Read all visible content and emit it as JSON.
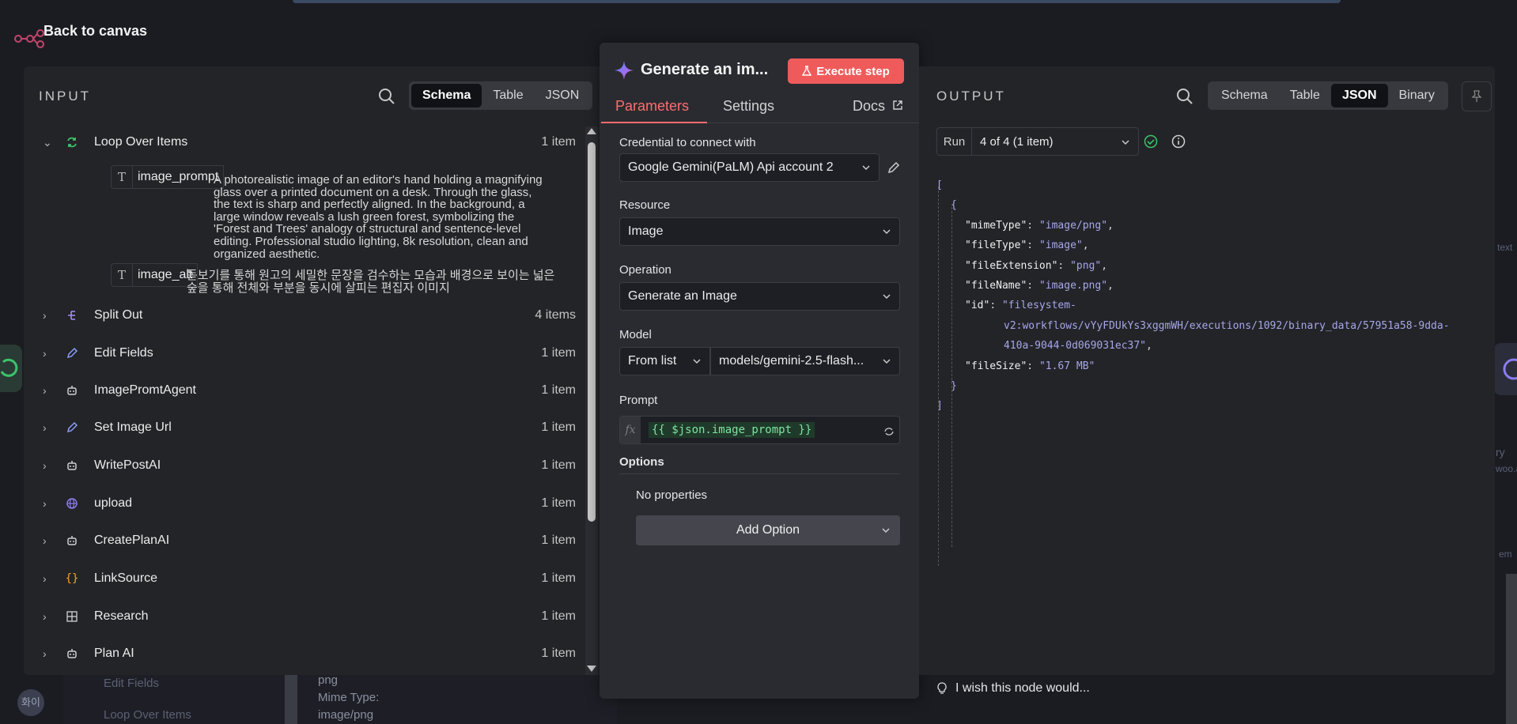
{
  "header": {
    "back_label": "Back to canvas"
  },
  "input": {
    "title": "INPUT",
    "view_tabs": [
      "Schema",
      "Table",
      "JSON"
    ],
    "active_tab": "Schema",
    "nodes": [
      {
        "label": "Loop Over Items",
        "count": "1 item",
        "icon": "loop-icon",
        "expanded": true
      },
      {
        "label": "Split Out",
        "count": "4 items",
        "icon": "split-out-icon"
      },
      {
        "label": "Edit Fields",
        "count": "1 item",
        "icon": "pencil-icon"
      },
      {
        "label": "ImagePromtAgent",
        "count": "1 item",
        "icon": "robot-icon"
      },
      {
        "label": "Set Image Url",
        "count": "1 item",
        "icon": "pencil-icon"
      },
      {
        "label": "WritePostAI",
        "count": "1 item",
        "icon": "robot-icon"
      },
      {
        "label": "upload",
        "count": "1 item",
        "icon": "globe-icon"
      },
      {
        "label": "CreatePlanAI",
        "count": "1 item",
        "icon": "robot-icon"
      },
      {
        "label": "LinkSource",
        "count": "1 item",
        "icon": "braces-icon"
      },
      {
        "label": "Research",
        "count": "1 item",
        "icon": "perplexity-icon"
      },
      {
        "label": "Plan AI",
        "count": "1 item",
        "icon": "robot-icon"
      }
    ],
    "fields": [
      {
        "name": "image_prompt",
        "type_glyph": "T",
        "value_lines": [
          "A photorealistic image of an editor's hand holding a magnifying",
          "glass over a printed document on a desk. Through the glass,",
          "the text is sharp and perfectly aligned. In the background, a",
          "large window reveals a lush green forest, symbolizing the",
          "'Forest and Trees' analogy of structural and sentence-level",
          "editing. Professional studio lighting, 8k resolution, clean and",
          "organized aesthetic."
        ]
      },
      {
        "name": "image_alt",
        "type_glyph": "T",
        "value_lines": [
          "돋보기를 통해 원고의 세밀한 문장을 검수하는 모습과 배경으로 보이는 넓은",
          "숲을 통해 전체와 부분을 동시에 살피는 편집자 이미지"
        ]
      }
    ]
  },
  "node": {
    "title": "Generate an im...",
    "execute_label": "Execute step",
    "tabs": {
      "parameters": "Parameters",
      "settings": "Settings",
      "docs": "Docs"
    },
    "credential_label": "Credential to connect with",
    "credential_value": "Google Gemini(PaLM) Api account 2",
    "resource_label": "Resource",
    "resource_value": "Image",
    "operation_label": "Operation",
    "operation_value": "Generate an Image",
    "model_label": "Model",
    "model_mode": "From list",
    "model_value": "models/gemini-2.5-flash...",
    "prompt_label": "Prompt",
    "prompt_fx": "fx",
    "prompt_value": "{{ $json.image_prompt }}",
    "options_label": "Options",
    "no_properties": "No properties",
    "add_option": "Add Option"
  },
  "output": {
    "title": "OUTPUT",
    "view_tabs": [
      "Schema",
      "Table",
      "JSON",
      "Binary"
    ],
    "active_tab": "JSON",
    "run_label": "Run",
    "run_value": "4 of 4 (1 item)",
    "json": {
      "open_bracket": "[",
      "open_brace": "{",
      "close_brace": "}",
      "close_bracket": "]",
      "entries": [
        {
          "key": "\"mimeType\"",
          "value": "\"image/png\""
        },
        {
          "key": "\"fileType\"",
          "value": "\"image\""
        },
        {
          "key": "\"fileExtension\"",
          "value": "\"png\""
        },
        {
          "key": "\"fileName\"",
          "value": "\"image.png\""
        },
        {
          "key": "\"id\"",
          "value_lines": [
            "\"filesystem-",
            "v2:workflows/vYyFDUkYs3xggmWH/executions/1092/binary_data/57951a58-9dda-",
            "410a-9044-0d069031ec37\""
          ]
        },
        {
          "key": "\"fileSize\"",
          "value": "\"1.67 MB\""
        }
      ]
    },
    "feedback": "I wish this node would..."
  },
  "background": {
    "avatar_text": "화이",
    "bottom_items": [
      "Edit Fields",
      "Loop Over Items"
    ],
    "bottom_values": [
      "png",
      "Mime Type:",
      "image/png"
    ],
    "right_fragments": [
      "text",
      "ry",
      "woo.a",
      "em"
    ]
  },
  "colors": {
    "accent": "#ff6d6d",
    "execute": "#ef5b5b",
    "success": "#3cc36b",
    "json_string": "#a7a7e8",
    "expression": "#7ee3a2"
  }
}
